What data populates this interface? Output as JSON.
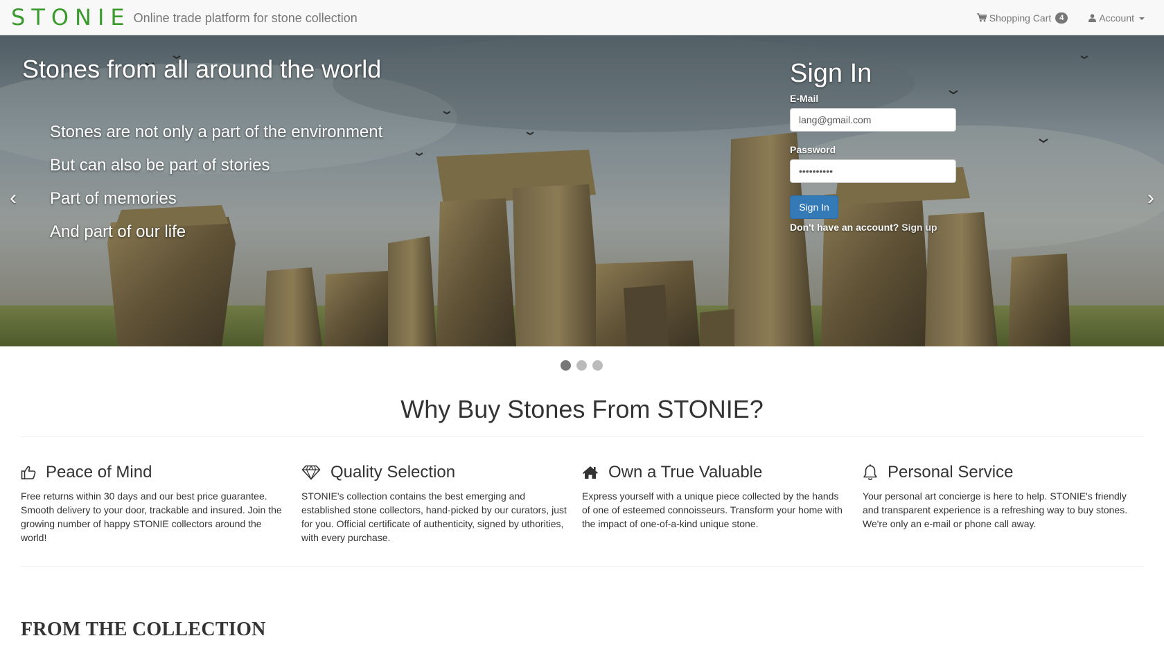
{
  "navbar": {
    "brand": "STONIE",
    "tagline": "Online trade platform for stone collection",
    "cart_label": "Shopping Cart",
    "cart_count": "4",
    "account_label": "Account"
  },
  "hero": {
    "title": "Stones from all around the world",
    "lines": [
      "Stones are not only a part of the environment",
      "But can also be part of stories",
      "Part of memories",
      "And part of our life"
    ],
    "prev_glyph": "‹",
    "next_glyph": "›",
    "indicators": [
      true,
      false,
      false
    ]
  },
  "signin": {
    "title": "Sign In",
    "email_label": "E-Mail",
    "email_value": "lang@gmail.com",
    "password_label": "Password",
    "password_value": "••••••••••",
    "button_label": "Sign In",
    "signup_prompt": "Don't have an account?",
    "signup_link": "Sign up"
  },
  "why": {
    "title": "Why Buy Stones From STONIE?",
    "features": [
      {
        "icon": "thumbs-up-icon",
        "title": "Peace of Mind",
        "text": "Free returns within 30 days and our best price guarantee. Smooth delivery to your door, trackable and insured. Join the growing number of happy STONIE collectors around the world!"
      },
      {
        "icon": "diamond-icon",
        "title": "Quality Selection",
        "text": "STONIE's collection contains the best emerging and established stone collectors, hand-picked by our curators, just for you. Official certificate of authenticity, signed by uthorities, with every purchase."
      },
      {
        "icon": "home-icon",
        "title": "Own a True Valuable",
        "text": "Express yourself with a unique piece collected by the hands of one of esteemed connoisseurs. Transform your home with the impact of one-of-a-kind unique stone."
      },
      {
        "icon": "bell-icon",
        "title": "Personal Service",
        "text": "Your personal art concierge is here to help. STONIE's friendly and transparent experience is a refreshing way to buy stones. We're only an e-mail or phone call away."
      }
    ]
  },
  "collection": {
    "title": "FROM THE COLLECTION"
  }
}
